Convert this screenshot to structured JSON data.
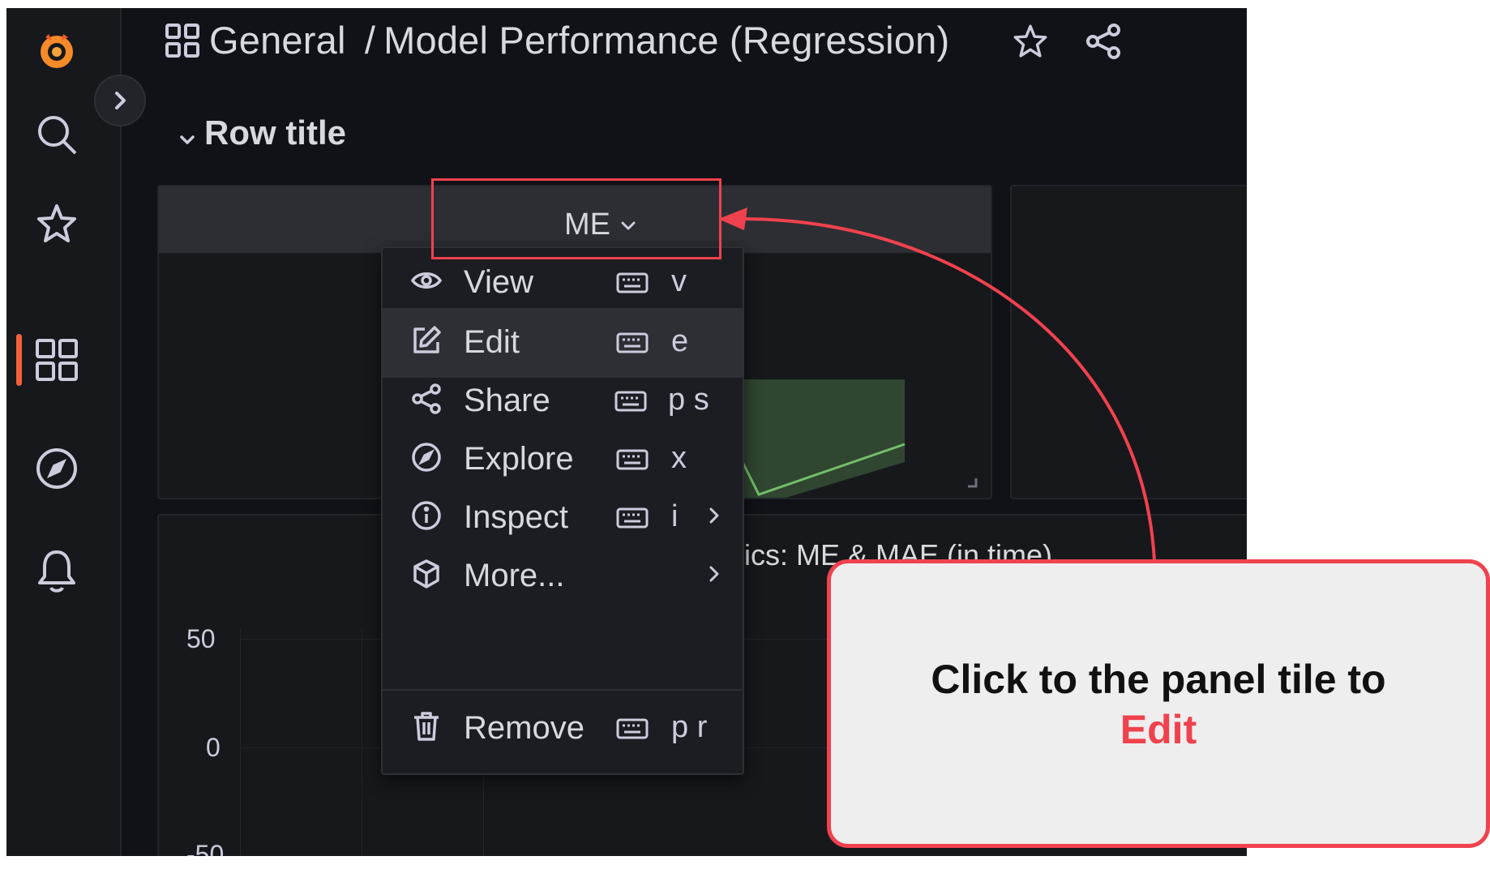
{
  "breadcrumb": {
    "folder": "General",
    "separator": "/",
    "dashboard": "Model Performance (Regression)"
  },
  "row": {
    "title": "Row title"
  },
  "panels": {
    "me": {
      "title": "ME"
    },
    "bottom": {
      "title_visible": "rics: ME & MAE (in time)"
    }
  },
  "chart_axis": {
    "ticks": [
      "50",
      "0",
      "-50"
    ]
  },
  "menu": {
    "items": [
      {
        "label": "View",
        "shortcut": "v",
        "icon": "eye-icon"
      },
      {
        "label": "Edit",
        "shortcut": "e",
        "icon": "edit-icon"
      },
      {
        "label": "Share",
        "shortcut": "p s",
        "icon": "share-icon"
      },
      {
        "label": "Explore",
        "shortcut": "x",
        "icon": "compass-icon"
      },
      {
        "label": "Inspect",
        "shortcut": "i",
        "icon": "info-icon"
      },
      {
        "label": "More...",
        "shortcut": "",
        "icon": "cube-icon"
      },
      {
        "label": "Remove",
        "shortcut": "p r",
        "icon": "trash-icon"
      }
    ]
  },
  "callout": {
    "text": "Click to the panel tile to",
    "accent": "Edit"
  },
  "colors": {
    "brand": "#f55f3e",
    "annotation": "#f0424e",
    "background": "#111217",
    "panel": "#17181c",
    "series": "#73bf69"
  },
  "sidebar_icons": [
    "grafana-logo-icon",
    "search-icon",
    "star-icon",
    "dashboards-icon",
    "explore-compass-icon",
    "bell-icon"
  ]
}
